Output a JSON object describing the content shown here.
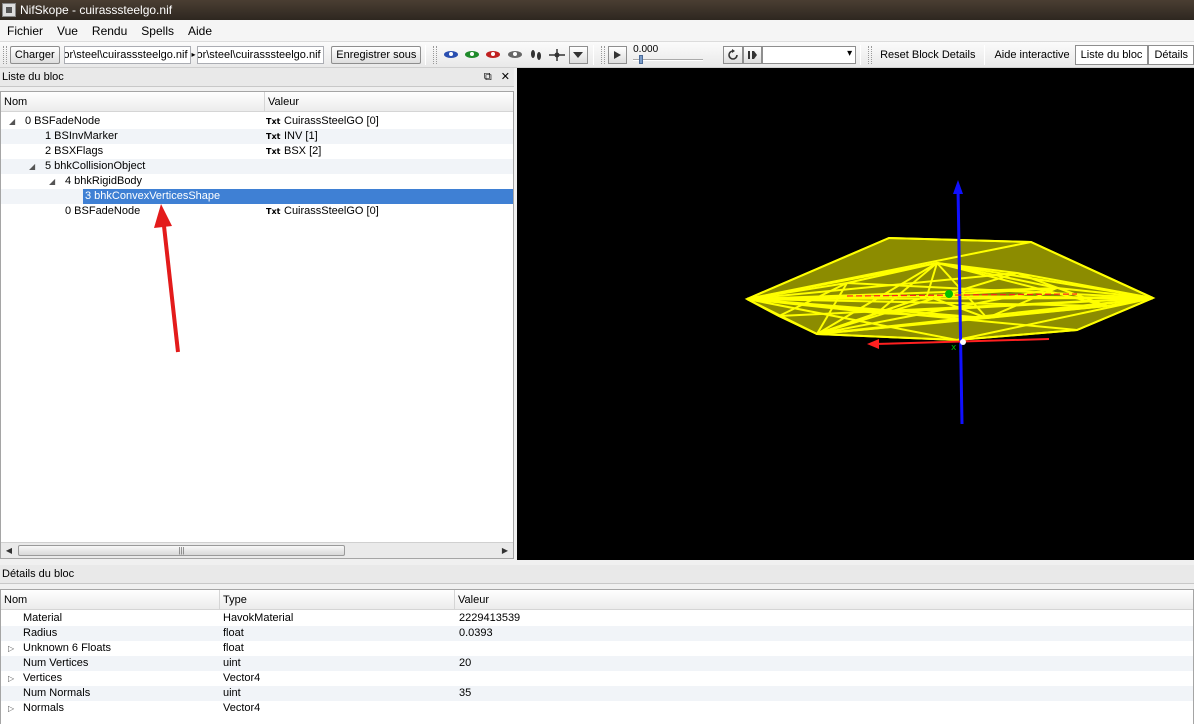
{
  "window": {
    "title": "NifSkope - cuirasssteelgo.nif"
  },
  "menubar": {
    "items": [
      "Fichier",
      "Vue",
      "Rendu",
      "Spells",
      "Aide"
    ]
  },
  "toolbar": {
    "load_label": "Charger",
    "load_path": "armor\\steel\\cuirasssteelgo.nif",
    "save_path": "armor\\steel\\cuirasssteelgo.nif",
    "save_label": "Enregistrer sous",
    "time_value": "0.000",
    "reset_label": "Reset Block Details",
    "help_label": "Aide interactive",
    "block_list_label": "Liste du bloc",
    "details_label": "Détails"
  },
  "block_list": {
    "title": "Liste du bloc",
    "col_name": "Nom",
    "col_value": "Valeur",
    "rows": [
      {
        "name": "0 BSFadeNode",
        "value": "CuirassSteelGO [0]",
        "badge": "Txt",
        "depth": 0,
        "expander": "open"
      },
      {
        "name": "1 BSInvMarker",
        "value": "INV [1]",
        "badge": "Txt",
        "depth": 1,
        "expander": ""
      },
      {
        "name": "2 BSXFlags",
        "value": "BSX [2]",
        "badge": "Txt",
        "depth": 1,
        "expander": ""
      },
      {
        "name": "5 bhkCollisionObject",
        "value": "",
        "badge": "",
        "depth": 1,
        "expander": "open"
      },
      {
        "name": "4 bhkRigidBody",
        "value": "",
        "badge": "",
        "depth": 2,
        "expander": "open"
      },
      {
        "name": "3 bhkConvexVerticesShape",
        "value": "",
        "badge": "",
        "depth": 3,
        "expander": "",
        "selected": true
      },
      {
        "name": "0 BSFadeNode",
        "value": "CuirassSteelGO [0]",
        "badge": "Txt",
        "depth": 2,
        "expander": ""
      }
    ]
  },
  "block_details": {
    "title": "Détails du bloc",
    "col_name": "Nom",
    "col_type": "Type",
    "col_value": "Valeur",
    "rows": [
      {
        "name": "Material",
        "type": "HavokMaterial",
        "value": "2229413539",
        "expander": ""
      },
      {
        "name": "Radius",
        "type": "float",
        "value": "0.0393",
        "expander": ""
      },
      {
        "name": "Unknown 6 Floats",
        "type": "float",
        "value": "",
        "expander": "closed"
      },
      {
        "name": "Num Vertices",
        "type": "uint",
        "value": "20",
        "expander": ""
      },
      {
        "name": "Vertices",
        "type": "Vector4",
        "value": "",
        "expander": "closed"
      },
      {
        "name": "Num Normals",
        "type": "uint",
        "value": "35",
        "expander": ""
      },
      {
        "name": "Normals",
        "type": "Vector4",
        "value": "",
        "expander": "closed"
      }
    ]
  },
  "colors": {
    "selection": "#3f80d4",
    "annotation_arrow": "#e31b1b",
    "mesh": "#ffff00",
    "axis_x": "#ff2020",
    "axis_y": "#00c000",
    "axis_z": "#1010ff"
  },
  "icons": [
    "eye-blue-icon",
    "eye-green-icon",
    "eye-red-icon",
    "eye-gray-icon",
    "footprint-icon",
    "light-icon",
    "play-icon",
    "refresh-icon",
    "pause-icon"
  ]
}
